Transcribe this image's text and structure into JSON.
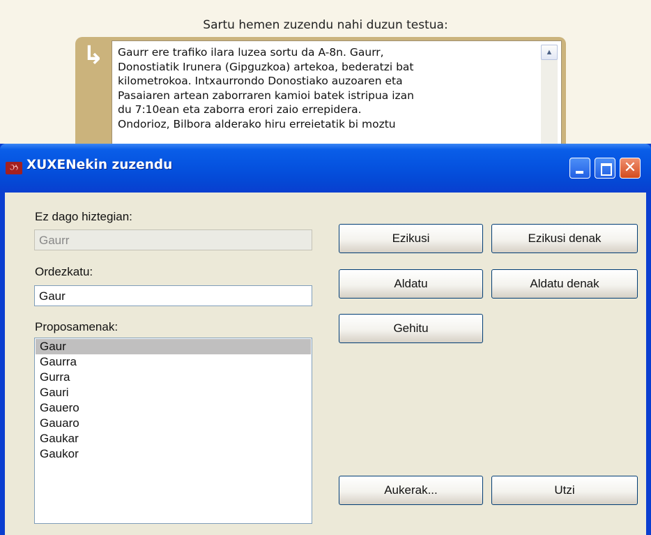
{
  "page": {
    "prompt": "Sartu hemen zuzendu nahi duzun testua:",
    "arrow_icon": "return-arrow-icon",
    "text_lines": [
      "Gaurr ere trafiko ilara luzea sortu da A-8n. Gaurr,",
      "Donostiatik Irunera (Gipguzkoa) artekoa, bederatzi bat",
      "kilometrokoa. Intxaurrondo Donostiako auzoaren eta",
      "Pasaiaren artean zaborraren kamioi batek istripua izan",
      "du 7:10ean eta zaborra erori zaio errepidera.",
      "Ondorioz, Bilbora alderako hiru erreietatik bi moztu"
    ]
  },
  "dialog": {
    "title": "XUXENekin zuzendu",
    "not_in_dict_label": "Ez dago hiztegian:",
    "not_in_dict_value": "Gaurr",
    "replace_label": "Ordezkatu:",
    "replace_value": "Gaur",
    "suggestions_label": "Proposamenak:",
    "suggestions": [
      "Gaur",
      "Gaurra",
      "Gurra",
      "Gauri",
      "Gauero",
      "Gauaro",
      "Gaukar",
      "Gaukor"
    ],
    "selected_suggestion": "Gaur",
    "buttons": {
      "ignore": "Ezikusi",
      "ignore_all": "Ezikusi denak",
      "change": "Aldatu",
      "change_all": "Aldatu denak",
      "add": "Gehitu",
      "options": "Aukerak...",
      "cancel": "Utzi"
    }
  },
  "colors": {
    "titlebar": "#0553e0",
    "close_button": "#d34b1c",
    "dialog_body": "#ece9d8",
    "page_frame": "#cbb37c",
    "selection": "#c0bfbf"
  }
}
